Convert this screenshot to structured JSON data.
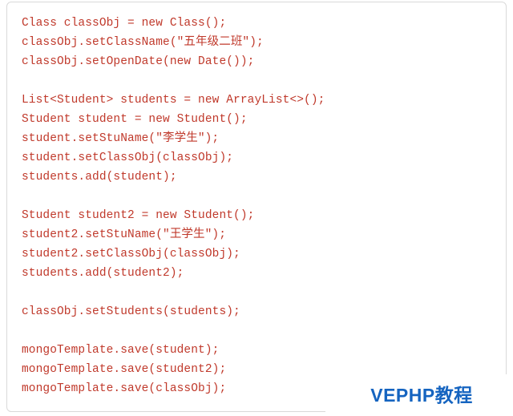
{
  "code": {
    "lines": [
      "Class classObj = new Class();",
      "classObj.setClassName(\"五年级二班\");",
      "classObj.setOpenDate(new Date());",
      "",
      "List<Student> students = new ArrayList<>();",
      "Student student = new Student();",
      "student.setStuName(\"李学生\");",
      "student.setClassObj(classObj);",
      "students.add(student);",
      "",
      "Student student2 = new Student();",
      "student2.setStuName(\"王学生\");",
      "student2.setClassObj(classObj);",
      "students.add(student2);",
      "",
      "classObj.setStudents(students);",
      "",
      "mongoTemplate.save(student);",
      "mongoTemplate.save(student2);",
      "mongoTemplate.save(classObj);"
    ]
  },
  "watermark": {
    "text": "VEPHP教程"
  }
}
